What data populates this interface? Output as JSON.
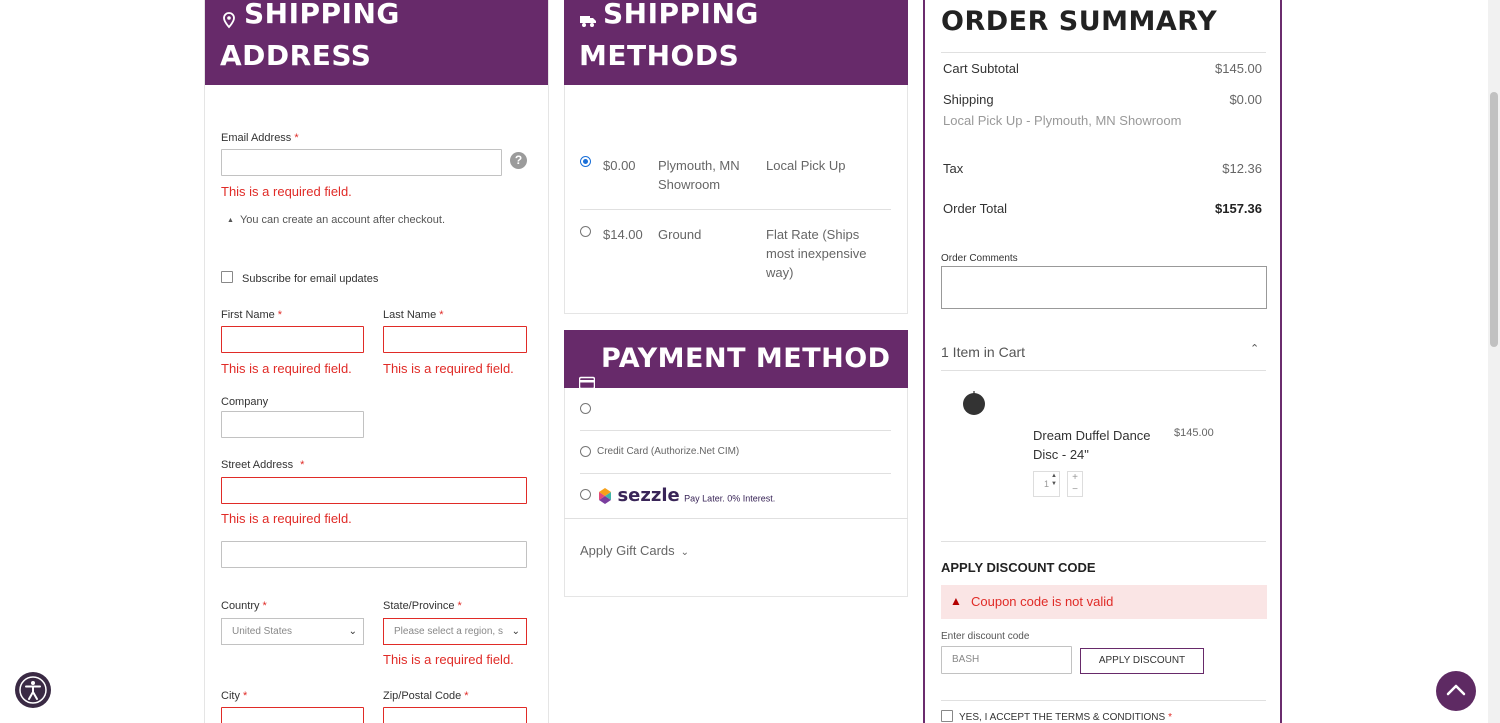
{
  "shipping_address": {
    "title_line1": "SHIPPING",
    "title_line2": "ADDRESS",
    "email_label": "Email Address",
    "required_mark": "*",
    "required_error": "This is a required field.",
    "account_hint": "You can create an account after checkout.",
    "subscribe_label": "Subscribe for email updates",
    "first_name_label": "First Name",
    "last_name_label": "Last Name",
    "company_label": "Company",
    "street_label": "Street Address",
    "country_label": "Country",
    "country_value": "United States",
    "state_label": "State/Province",
    "state_placeholder": "Please select a region, s",
    "city_label": "City",
    "zip_label": "Zip/Postal Code"
  },
  "shipping_methods": {
    "title_line1": "SHIPPING",
    "title_line2": "METHODS",
    "options": [
      {
        "price": "$0.00",
        "method": "Plymouth, MN Showroom",
        "carrier": "Local Pick Up",
        "selected": true
      },
      {
        "price": "$14.00",
        "method": "Ground",
        "carrier": "Flat Rate (Ships most inexpensive way)",
        "selected": false
      }
    ]
  },
  "payment_method": {
    "title": "PAYMENT METHOD",
    "credit_card_label": "Credit Card (Authorize.Net CIM)",
    "sezzle_brand": "sezzle",
    "sezzle_tagline": "Pay Later. 0% Interest.",
    "gift_cards_label": "Apply Gift Cards"
  },
  "order_summary": {
    "title": "ORDER SUMMARY",
    "cart_subtotal_label": "Cart Subtotal",
    "cart_subtotal_value": "$145.00",
    "shipping_label": "Shipping",
    "shipping_value": "$0.00",
    "shipping_detail": "Local Pick Up - Plymouth, MN Showroom",
    "tax_label": "Tax",
    "tax_value": "$12.36",
    "order_total_label": "Order Total",
    "order_total_value": "$157.36",
    "comments_label": "Order Comments",
    "items_in_cart": "1 Item in Cart",
    "item": {
      "name": "Dream Duffel Dance Disc - 24\"",
      "price": "$145.00",
      "qty": "1"
    },
    "discount_title": "APPLY DISCOUNT CODE",
    "discount_error": "Coupon code is not valid",
    "discount_input_label": "Enter discount code",
    "discount_value": "BASH",
    "apply_discount_button": "APPLY DISCOUNT",
    "terms_label": "YES, I ACCEPT THE TERMS & CONDITIONS"
  },
  "colors": {
    "brand": "#672a6a",
    "error": "#e02b27",
    "radio": "#1a6fd8"
  }
}
